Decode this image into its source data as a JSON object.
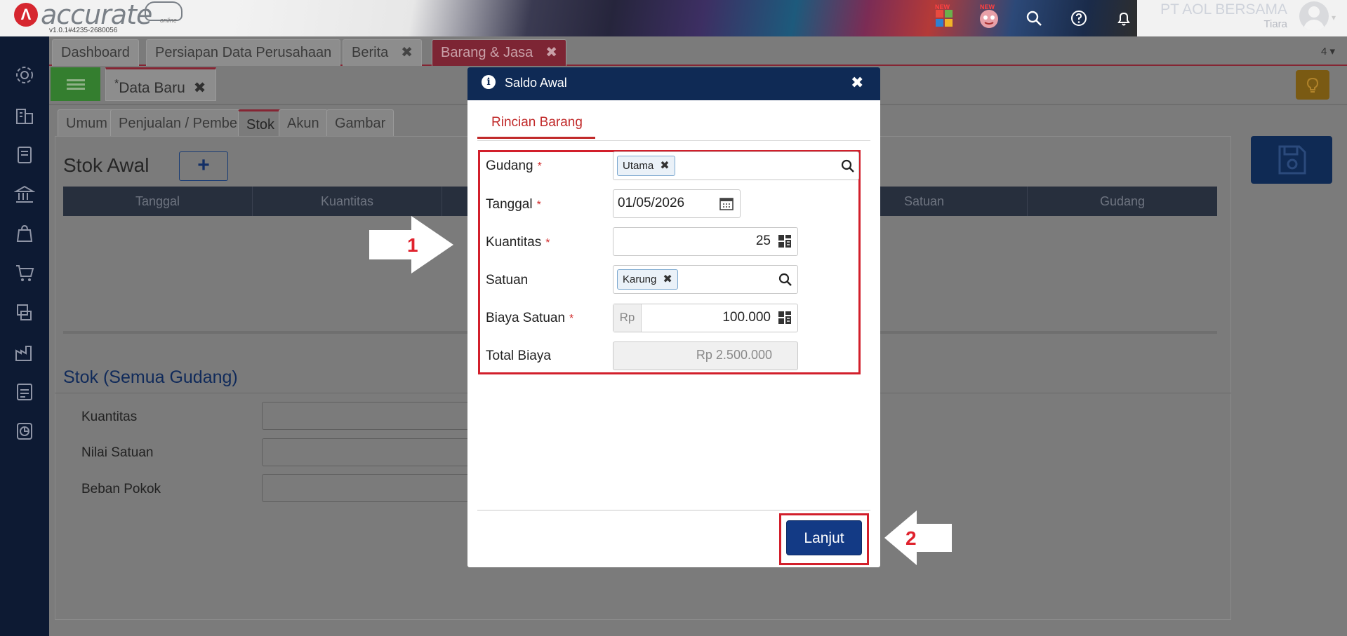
{
  "app": {
    "logo_text": "accurate",
    "logo_sub": "online",
    "version": "v1.0.1#4235-2680056",
    "new_badge_1": "NEW",
    "new_badge_2": "NEW",
    "company_name": "PT AOL BERSAMA",
    "user_name": "Tiara"
  },
  "tabs": [
    {
      "label": "Dashboard"
    },
    {
      "label": "Persiapan Data Perusahaan"
    },
    {
      "label": "Berita",
      "close": "✖"
    },
    {
      "label": "Barang & Jasa",
      "close": "✖"
    }
  ],
  "tab_count": "4",
  "doc_tab": {
    "prefix": "*",
    "label": "Data Baru",
    "close": "✖"
  },
  "subtabs": [
    {
      "label": "Umum"
    },
    {
      "label": "Penjualan / Pembelian"
    },
    {
      "label": "Stok"
    },
    {
      "label": "Akun"
    },
    {
      "label": "Gambar"
    }
  ],
  "stok_awal": {
    "title": "Stok Awal",
    "add_label": "+",
    "columns": [
      "Tanggal",
      "Kuantitas",
      "",
      "",
      "Satuan",
      "Gudang"
    ]
  },
  "stok_semua": {
    "title": "Stok (Semua Gudang)",
    "rows": [
      {
        "label": "Kuantitas"
      },
      {
        "label": "Nilai Satuan"
      },
      {
        "label": "Beban Pokok"
      }
    ]
  },
  "modal": {
    "title": "Saldo Awal",
    "info_glyph": "i",
    "close_glyph": "✖",
    "tab_label": "Rincian Barang",
    "required_mark": "*",
    "fields": {
      "gudang": {
        "label": "Gudang",
        "chip": "Utama",
        "chip_close": "✖"
      },
      "tanggal": {
        "label": "Tanggal",
        "value": "01/05/2026"
      },
      "kuantitas": {
        "label": "Kuantitas",
        "value": "25"
      },
      "satuan": {
        "label": "Satuan",
        "chip": "Karung",
        "chip_close": "✖"
      },
      "biaya_satuan": {
        "label": "Biaya Satuan",
        "prefix": "Rp",
        "value": "100.000"
      },
      "total_biaya": {
        "label": "Total Biaya",
        "value": "Rp 2.500.000"
      }
    },
    "submit_label": "Lanjut"
  },
  "annotations": {
    "step1": "1",
    "step2": "2"
  },
  "colors": {
    "accent_red": "#c12a2a",
    "navy": "#0f2a55",
    "button_blue": "#133a85",
    "annotation_red": "#d21f2b"
  },
  "icons": [
    "settings-icon",
    "company-icon",
    "ledger-icon",
    "bank-icon",
    "sales-bag-icon",
    "cart-icon",
    "inventory-icon",
    "factory-icon",
    "tax-icon",
    "report-icon",
    "apps-icon",
    "mascot-icon",
    "search-icon",
    "help-icon",
    "bell-icon",
    "calendar-icon",
    "calculator-icon",
    "save-icon",
    "bulb-icon"
  ]
}
